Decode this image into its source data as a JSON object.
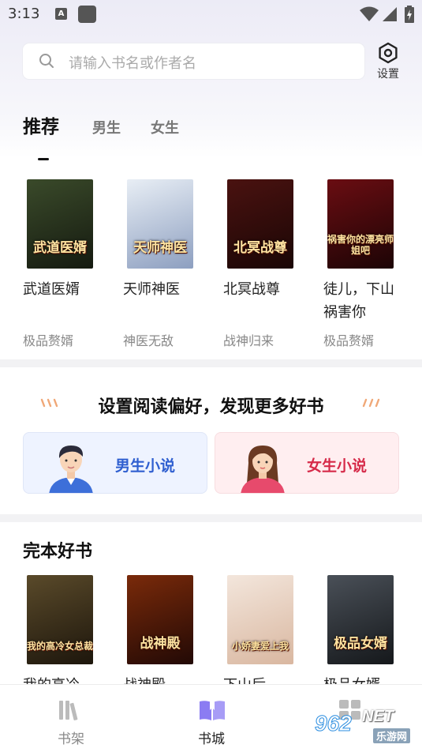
{
  "status": {
    "time": "3:13",
    "a_badge": "A"
  },
  "search": {
    "placeholder": "请输入书名或作者名",
    "settings_label": "设置"
  },
  "tabs": [
    {
      "label": "推荐"
    },
    {
      "label": "男生"
    },
    {
      "label": "女生"
    }
  ],
  "recommend_books": [
    {
      "name": "武道医婿",
      "tag": "极品赘婿",
      "cover_title": "武道医婿",
      "colors": [
        "#3a4a2a",
        "#151a10"
      ]
    },
    {
      "name": "天师神医",
      "tag": "神医无敌",
      "cover_title": "天师神医",
      "colors": [
        "#e8eef5",
        "#8d9fc0"
      ]
    },
    {
      "name": "北冥战尊",
      "tag": "战神归来",
      "cover_title": "北冥战尊",
      "colors": [
        "#4a1210",
        "#1a0605"
      ]
    },
    {
      "name": "徒儿，下山祸害你",
      "tag": "极品赘婿",
      "cover_title": "祸害你的漂亮师姐吧",
      "colors": [
        "#6a0d12",
        "#1c0405"
      ]
    }
  ],
  "preference": {
    "title": "设置阅读偏好，发现更多好书",
    "male_label": "男生小说",
    "female_label": "女生小说"
  },
  "complete": {
    "title": "完本好书",
    "books": [
      {
        "name": "我的高冷",
        "cover_title": "我的高冷女总裁",
        "colors": [
          "#5a4a2a",
          "#1d160c"
        ]
      },
      {
        "name": "战神殿",
        "cover_title": "战神殿",
        "colors": [
          "#7a2a0a",
          "#220905"
        ]
      },
      {
        "name": "下山后",
        "cover_title": "小娇妻爱上我",
        "colors": [
          "#f3e6dc",
          "#d9b7a0"
        ]
      },
      {
        "name": "极品女婿",
        "cover_title": "极品女婿",
        "colors": [
          "#4a5058",
          "#15181b"
        ]
      }
    ]
  },
  "nav": [
    {
      "label": "书架",
      "icon": "bookshelf-icon"
    },
    {
      "label": "书城",
      "icon": "bookstore-icon"
    },
    {
      "label": "",
      "icon": "grid-icon"
    }
  ],
  "watermark": {
    "logo": "962",
    "text": "NET",
    "sub": "乐游网"
  },
  "colors": {
    "accent_blue": "#2f5fd0",
    "accent_red": "#d62a49",
    "nav_active": "#8b7cf2"
  }
}
